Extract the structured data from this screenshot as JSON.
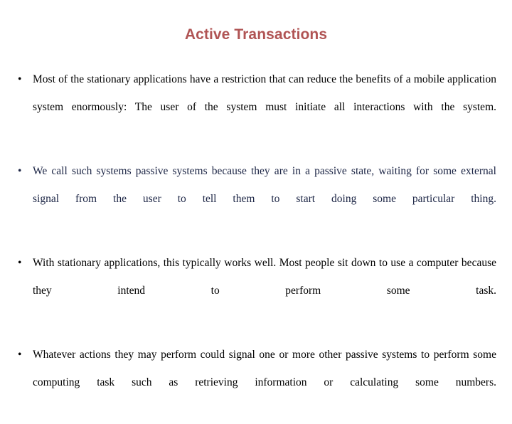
{
  "slide": {
    "title": "Active Transactions",
    "title_color": "#b05454",
    "background_color": "#ffffff",
    "bullet_glyph": "•",
    "bullets": [
      {
        "text": "Most of the stationary applications have a restriction that can reduce the benefits of a mobile application system enormously: The user of the system must initiate all interactions with the system.",
        "color": "#000000",
        "tone": "tone-black"
      },
      {
        "text": "We call such systems passive systems because they are in a passive state, waiting for some external signal from the user to tell them to start doing some particular thing.",
        "color": "#1c2545",
        "tone": "tone-navy"
      },
      {
        "text": "With stationary applications, this typically works well. Most people sit down to use a computer because they intend to perform some task.",
        "color": "#000000",
        "tone": "tone-black"
      },
      {
        "text": "Whatever actions they may perform could signal one or more other passive systems to perform some computing task such as retrieving information or calculating some numbers.",
        "color": "#000000",
        "tone": "tone-black"
      }
    ]
  }
}
